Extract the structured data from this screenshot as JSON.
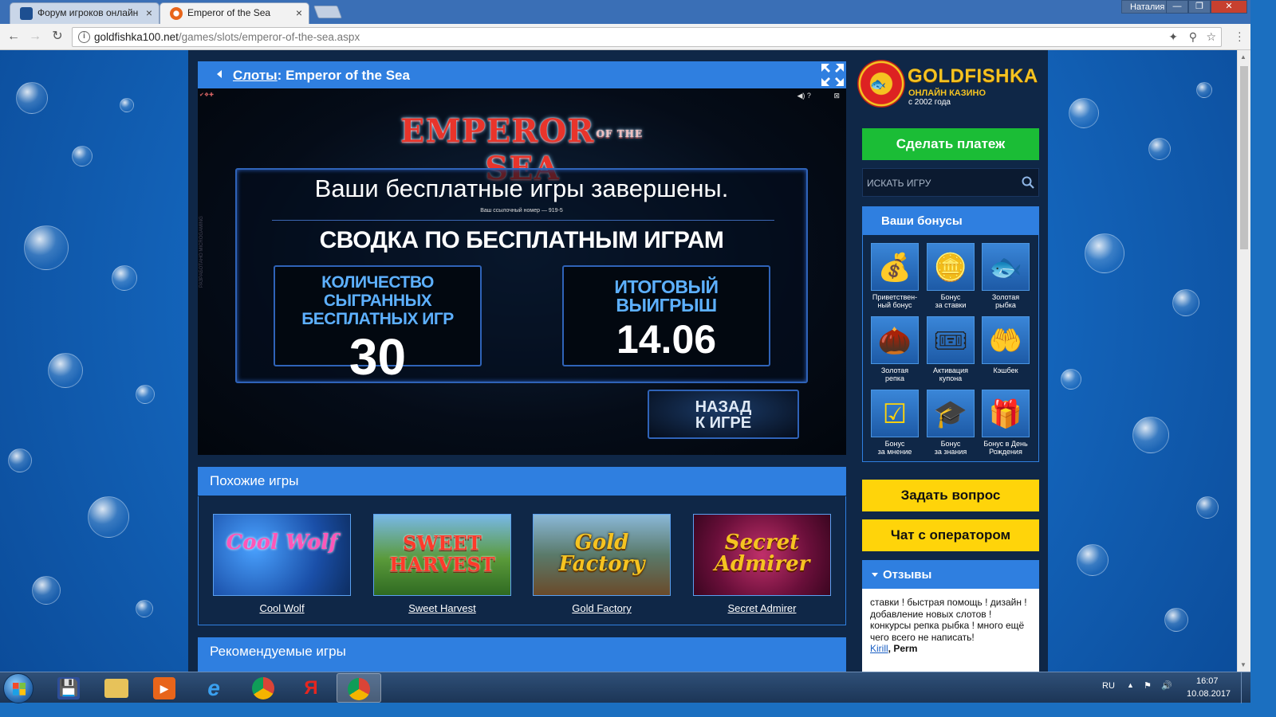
{
  "browser": {
    "tabs": [
      {
        "title": "Форум игроков онлайн",
        "favicon_color": "#1d4f91"
      },
      {
        "title": "Emperor of the Sea",
        "favicon_color": "#e8651a"
      }
    ],
    "user": "Наталия",
    "window_buttons": [
      "—",
      "❐",
      "✕"
    ],
    "url_host": "goldfishka100.net",
    "url_path": "/games/slots/emperor-of-the-sea.aspx"
  },
  "game": {
    "breadcrumb_link": "Слоты",
    "breadcrumb_separator": ":",
    "breadcrumb_title": "Emperor of the Sea",
    "logo_main_left": "EMPEROR",
    "logo_small": "OF THE",
    "logo_main_right": "SEA",
    "headline": "Ваши  бесплатные игры завершены.",
    "reference": "Ваш ссылочный номер — 919-5",
    "summary_title": "СВОДКА ПО БЕСПЛАТНЫМ ИГРАМ",
    "games_played_label": "КОЛИЧЕСТВО СЫГРАННЫХ БЕСПЛАТНЫХ ИГР",
    "games_played_value": "30",
    "total_win_label": "ИТОГОВЫЙ ВЫИГРЫШ",
    "total_win_value": "14.06",
    "back_label_1": "НАЗАД",
    "back_label_2": "К ИГРЕ",
    "side_text": "РАЗРАБОТАНО MICROGAMING"
  },
  "similar": {
    "title": "Похожие игры",
    "games": [
      {
        "name": "Cool Wolf",
        "thumb_text": "Cool Wolf",
        "bg": "#2c6fd0",
        "fg": "#ff4fb0"
      },
      {
        "name": "Sweet Harvest",
        "thumb_text": "SWEET HARVEST",
        "bg": "#2f8a3a",
        "fg": "#ff3a3a"
      },
      {
        "name": "Gold Factory",
        "thumb_text": "Gold Factory",
        "bg": "#3a6a8a",
        "fg": "#f5c321"
      },
      {
        "name": "Secret Admirer",
        "thumb_text": "Secret Admirer",
        "bg": "#7a1f5a",
        "fg": "#f5c321"
      }
    ]
  },
  "recommended": {
    "title": "Рекомендуемые игры"
  },
  "sidebar": {
    "brand": "GOLDFISHKA",
    "brand_sub": "ОНЛАЙН КАЗИНО",
    "brand_since": "с 2002 года",
    "pay_button": "Сделать платеж",
    "search_placeholder": "ИСКАТЬ ИГРУ",
    "bonuses_title": "Ваши бонусы",
    "bonuses": [
      {
        "l1": "Приветствен-",
        "l2": "ный бонус",
        "glyph": "💰"
      },
      {
        "l1": "Бонус",
        "l2": "за ставки",
        "glyph": "🪙"
      },
      {
        "l1": "Золотая",
        "l2": "рыбка",
        "glyph": "🐟"
      },
      {
        "l1": "Золотая репка",
        "l2": "",
        "glyph": "🌰"
      },
      {
        "l1": "Активация",
        "l2": "купона",
        "glyph": "🎟"
      },
      {
        "l1": "Кэшбек",
        "l2": "",
        "glyph": "🤲"
      },
      {
        "l1": "Бонус",
        "l2": "за мнение",
        "glyph": "☑"
      },
      {
        "l1": "Бонус",
        "l2": "за знания",
        "glyph": "🎓"
      },
      {
        "l1": "Бонус в День",
        "l2": "Рождения",
        "glyph": "🎁"
      }
    ],
    "ask_button": "Задать вопрос",
    "chat_button": "Чат с оператором",
    "reviews_title": "Отзывы",
    "review_text": "ставки ! быстрая помощь ! дизайн ! добавление новых слотов ! конкурсы репка рыбка ! много ещё чего всего не написать!",
    "review_author": "Kirill",
    "review_city": ", Perm"
  },
  "taskbar": {
    "lang": "RU",
    "time": "16:07",
    "date": "10.08.2017"
  }
}
